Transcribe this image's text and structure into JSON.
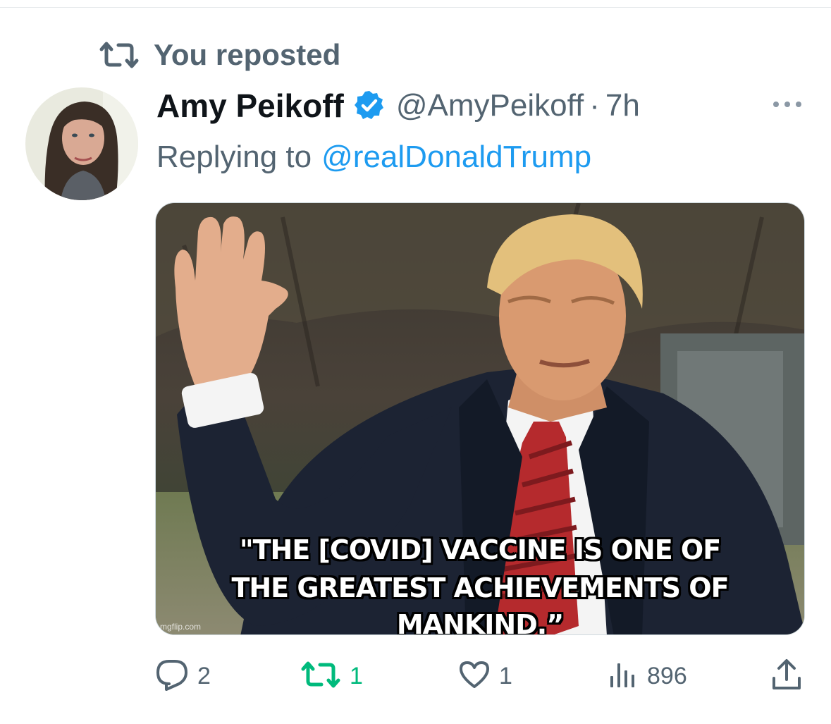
{
  "repost_banner": {
    "label": "You reposted",
    "icon": "repost-icon"
  },
  "tweet": {
    "author": {
      "display_name": "Amy Peikoff",
      "handle": "@AmyPeikoff",
      "verified": true
    },
    "separator": "·",
    "time": "7h",
    "reply": {
      "prefix": "Replying to",
      "handle": "@realDonaldTrump"
    },
    "media": {
      "caption_line1": "\"THE [COVID] VACCINE IS ONE OF",
      "caption_line2": "THE GREATEST ACHIEVEMENTS OF MANKIND.”",
      "watermark": "mgflip.com"
    },
    "actions": {
      "replies": "2",
      "reposts": "1",
      "likes": "1",
      "views": "896"
    }
  },
  "colors": {
    "text_primary": "#0f1419",
    "text_secondary": "#536471",
    "link": "#1d9bf0",
    "repost_active": "#00ba7c",
    "verified": "#1d9bf0"
  }
}
